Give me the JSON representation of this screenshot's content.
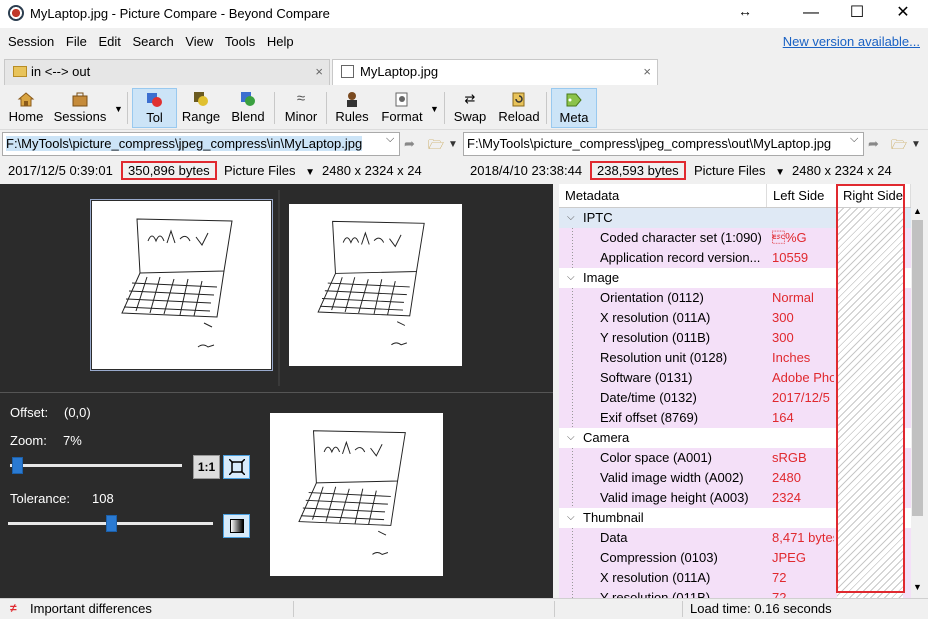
{
  "window": {
    "title": "MyLaptop.jpg - Picture Compare - Beyond Compare",
    "minimize": "—",
    "maximize": "☐",
    "close": "✕"
  },
  "menu": {
    "items": [
      "Session",
      "File",
      "Edit",
      "Search",
      "View",
      "Tools",
      "Help"
    ],
    "new_version": "New version available..."
  },
  "tabs": [
    {
      "label": "in <--> out",
      "close": "×"
    },
    {
      "label": "MyLaptop.jpg",
      "close": "×"
    }
  ],
  "toolbar": {
    "home": "Home",
    "sessions": "Sessions",
    "tol": "Tol",
    "range": "Range",
    "blend": "Blend",
    "minor": "Minor",
    "rules": "Rules",
    "format": "Format",
    "swap": "Swap",
    "reload": "Reload",
    "meta": "Meta"
  },
  "left": {
    "path": "F:\\MyTools\\picture_compress\\jpeg_compress\\in\\MyLaptop.jpg",
    "date": "2017/12/5 0:39:01",
    "size": "350,896 bytes",
    "format": "Picture Files",
    "dims": "2480 x 2324 x 24"
  },
  "right": {
    "path": "F:\\MyTools\\picture_compress\\jpeg_compress\\out\\MyLaptop.jpg",
    "date": "2018/4/10 23:38:44",
    "size": "238,593 bytes",
    "format": "Picture Files",
    "dims": "2480 x 2324 x 24"
  },
  "controls": {
    "offset_label": "Offset:",
    "offset_value": "(0,0)",
    "zoom_label": "Zoom:",
    "zoom_value": "7%",
    "zoom_fraction": 0.04,
    "tolerance_label": "Tolerance:",
    "tolerance_value": "108",
    "tolerance_fraction": 0.5,
    "one_to_one": "1:1"
  },
  "metadata": {
    "headers": {
      "name": "Metadata",
      "left": "Left Side",
      "right": "Right Side"
    },
    "rows": [
      {
        "type": "group",
        "name": "IPTC",
        "selected": true
      },
      {
        "type": "item",
        "name": "Coded character set (1:090)",
        "left": "\u001b%G"
      },
      {
        "type": "item",
        "name": "Application record version...",
        "left": "10559"
      },
      {
        "type": "group",
        "name": "Image"
      },
      {
        "type": "item",
        "name": "Orientation (0112)",
        "left": "Normal"
      },
      {
        "type": "item",
        "name": "X resolution (011A)",
        "left": "300"
      },
      {
        "type": "item",
        "name": "Y resolution (011B)",
        "left": "300"
      },
      {
        "type": "item",
        "name": "Resolution unit (0128)",
        "left": "Inches"
      },
      {
        "type": "item",
        "name": "Software (0131)",
        "left": "Adobe Pho"
      },
      {
        "type": "item",
        "name": "Date/time (0132)",
        "left": "2017/12/5"
      },
      {
        "type": "item",
        "name": "Exif offset (8769)",
        "left": "164"
      },
      {
        "type": "group",
        "name": "Camera"
      },
      {
        "type": "item",
        "name": "Color space (A001)",
        "left": "sRGB"
      },
      {
        "type": "item",
        "name": "Valid image width (A002)",
        "left": "2480"
      },
      {
        "type": "item",
        "name": "Valid image height (A003)",
        "left": "2324"
      },
      {
        "type": "group",
        "name": "Thumbnail"
      },
      {
        "type": "item",
        "name": "Data",
        "left": "8,471 bytes"
      },
      {
        "type": "item",
        "name": "Compression (0103)",
        "left": "JPEG"
      },
      {
        "type": "item",
        "name": "X resolution (011A)",
        "left": "72"
      },
      {
        "type": "item",
        "name": "Y resolution (011B)",
        "left": "72"
      }
    ]
  },
  "status": {
    "icon": "≠",
    "text": "Important differences",
    "load_time": "Load time: 0.16 seconds"
  },
  "colors": {
    "diff_red": "#e0292f",
    "accent_blue": "#cce4f7",
    "meta_pink": "#f4e0f8"
  }
}
